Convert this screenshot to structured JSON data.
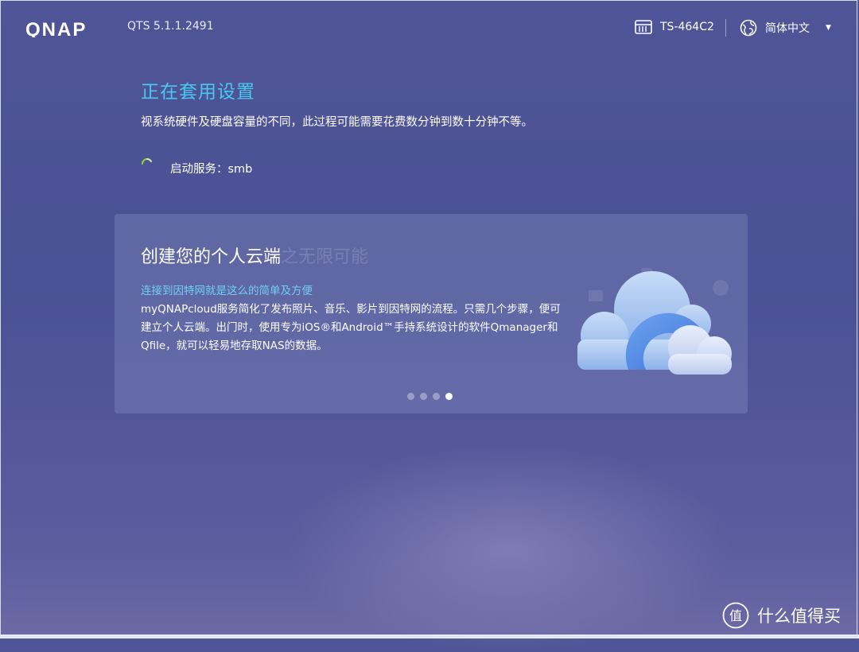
{
  "header": {
    "brand": "QNAP",
    "version": "QTS 5.1.1.2491",
    "device": "TS-464C2",
    "language": "简体中文"
  },
  "status": {
    "title": "正在套用设置",
    "description": "视系统硬件及硬盘容量的不同，此过程可能需要花费数分钟到数十分钟不等。",
    "step": "启动服务：smb"
  },
  "card": {
    "title": "创建您的个人云端",
    "title_fade": "之无限可能",
    "subtitle": "连接到因特网就是这么的简单及方便",
    "body": "myQNAPcloud服务简化了发布照片、音乐、影片到因特网的流程。只需几个步骤，便可建立个人云端。出门时，使用专为iOS®和Android™手持系统设计的软件Qmanager和Qfile，就可以轻易地存取NAS的数据。",
    "dots": 4,
    "active_dot": 4
  },
  "watermark": {
    "icon_text": "值",
    "text": "什么值得买"
  },
  "colors": {
    "accent": "#49c8f0",
    "subtitle": "#6fd0f5"
  }
}
